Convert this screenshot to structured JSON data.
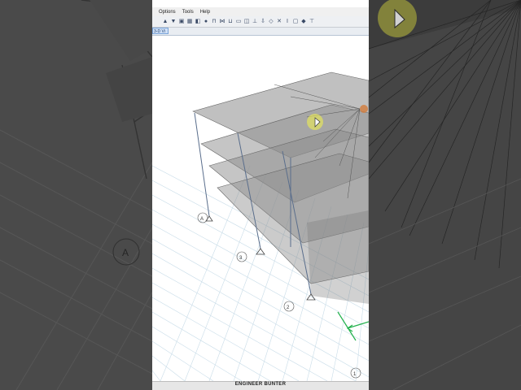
{
  "menu": {
    "items": [
      {
        "label": "Options"
      },
      {
        "label": "Tools"
      },
      {
        "label": "Help"
      }
    ]
  },
  "toolbar": {
    "icons": [
      "arrow-up-icon",
      "arrow-down-icon",
      "view-icon",
      "grid-icon",
      "layers-icon",
      "sphere-icon",
      "frame-icon",
      "brace-icon",
      "beam-icon",
      "slab-icon",
      "wall-icon",
      "support-icon",
      "load-icon",
      "node-icon",
      "x-icon",
      "column-icon",
      "select-icon",
      "point-icon",
      "link-icon"
    ]
  },
  "tab": {
    "label": "3-D Vi"
  },
  "grid_labels": {
    "left_a": "A",
    "bottom_2": "2",
    "bottom_3": "3",
    "left_a_side": "A",
    "corner_1": "1"
  },
  "watermark": "ENGINEER BUNTER",
  "colors": {
    "axis_green": "#22b14c",
    "grid_blue": "#c8dce8",
    "slab_fill": "#9a9a9a",
    "column_line": "#5a6e8c",
    "cursor_glow": "#e8e858"
  }
}
